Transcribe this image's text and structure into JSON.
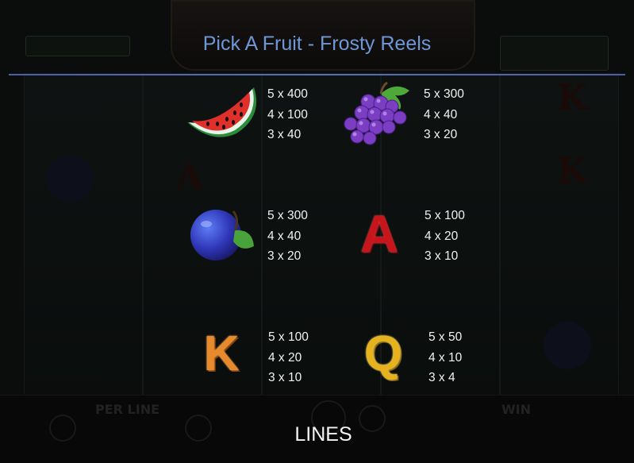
{
  "title": "Pick A Fruit - Frosty Reels",
  "symbols": [
    {
      "name": "watermelon",
      "pays": [
        "5 x 400",
        "4 x 100",
        "3 x 40"
      ]
    },
    {
      "name": "grapes",
      "pays": [
        "5 x 300",
        "4 x 40",
        "3 x 20"
      ]
    },
    {
      "name": "plum",
      "pays": [
        "5 x 300",
        "4 x 40",
        "3 x 20"
      ]
    },
    {
      "name": "letter-a",
      "glyph": "A",
      "pays": [
        "5 x 100",
        "4 x 20",
        "3 x 10"
      ]
    },
    {
      "name": "letter-k",
      "glyph": "K",
      "pays": [
        "5 x 100",
        "4 x 20",
        "3 x 10"
      ]
    },
    {
      "name": "letter-q",
      "glyph": "Q",
      "pays": [
        "5 x 50",
        "4 x 10",
        "3 x 4"
      ]
    }
  ],
  "footer": {
    "lines_label": "LINES"
  },
  "colors": {
    "title": "#6f97d6",
    "divider": "#5a6dbd",
    "text": "#f2f2f2"
  }
}
